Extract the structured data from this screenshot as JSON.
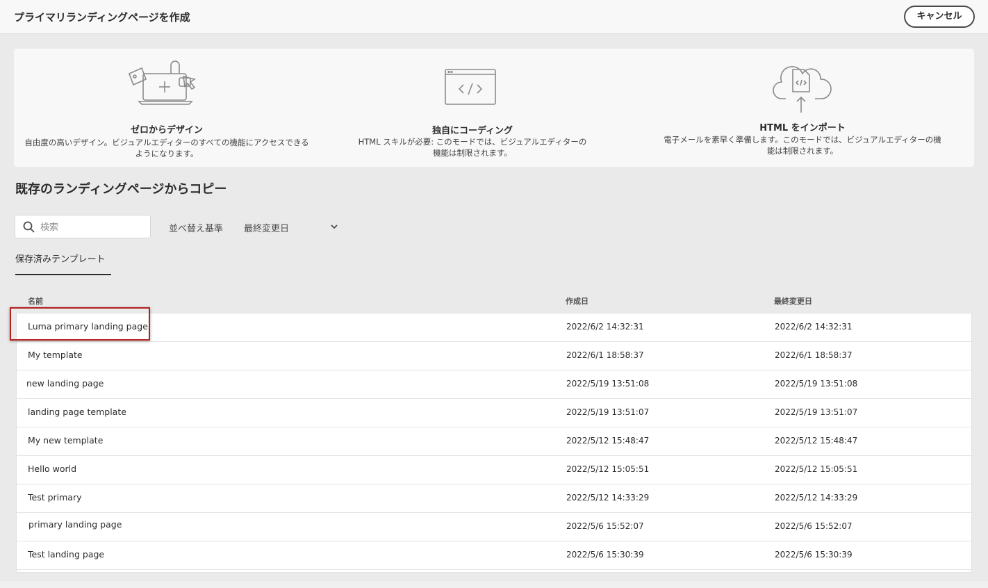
{
  "header": {
    "title": "プライマリランディングページを作成",
    "cancel_label": "キャンセル"
  },
  "cards": [
    {
      "icon": "design-from-scratch-illustration",
      "title": "ゼロからデザイン",
      "description": "自由度の高いデザイン。ビジュアルエディターのすべての機能にアクセスできるようになります。"
    },
    {
      "icon": "code-window-illustration",
      "title": "独自にコーディング",
      "description": "HTML スキルが必要: このモードでは、ビジュアルエディターの機能は制限されます。"
    },
    {
      "icon": "cloud-upload-html-illustration",
      "title": "HTML をインポート",
      "description": "電子メールを素早く準備します。このモードでは、ビジュアルエディターの機能は制限されます。"
    }
  ],
  "copy_section": {
    "title": "既存のランディングページからコピー",
    "search_placeholder": "検索",
    "sort_label": "並べ替え基準",
    "sort_value": "最終変更日",
    "tab_label": "保存済みテンプレート"
  },
  "table": {
    "columns": [
      "名前",
      "作成日",
      "最終変更日"
    ],
    "rows": [
      {
        "name": "Luma primary landing page",
        "created": "2022/6/2 14:32:31",
        "modified": "2022/6/2 14:32:31"
      },
      {
        "name": "My template",
        "created": "2022/6/1 18:58:37",
        "modified": "2022/6/1 18:58:37"
      },
      {
        "name": "new  landing page",
        "created": "2022/5/19 13:51:08",
        "modified": "2022/5/19 13:51:08"
      },
      {
        "name": "landing page template",
        "created": "2022/5/19 13:51:07",
        "modified": "2022/5/19 13:51:07"
      },
      {
        "name": "My new template",
        "created": "2022/5/12 15:48:47",
        "modified": "2022/5/12 15:48:47"
      },
      {
        "name": "Hello world",
        "created": "2022/5/12 15:05:51",
        "modified": "2022/5/12 15:05:51"
      },
      {
        "name": "Test primary",
        "created": "2022/5/12 14:33:29",
        "modified": "2022/5/12 14:33:29"
      },
      {
        "name": "primary landing page",
        "created": "2022/5/6 15:52:07",
        "modified": "2022/5/6 15:52:07"
      },
      {
        "name": "Test landing page",
        "created": "2022/5/6 15:30:39",
        "modified": "2022/5/6 15:30:39"
      }
    ]
  },
  "colors": {
    "highlight": "#b42020",
    "page_bg": "#eaeaea",
    "panel_bg": "#f8f8f8"
  }
}
